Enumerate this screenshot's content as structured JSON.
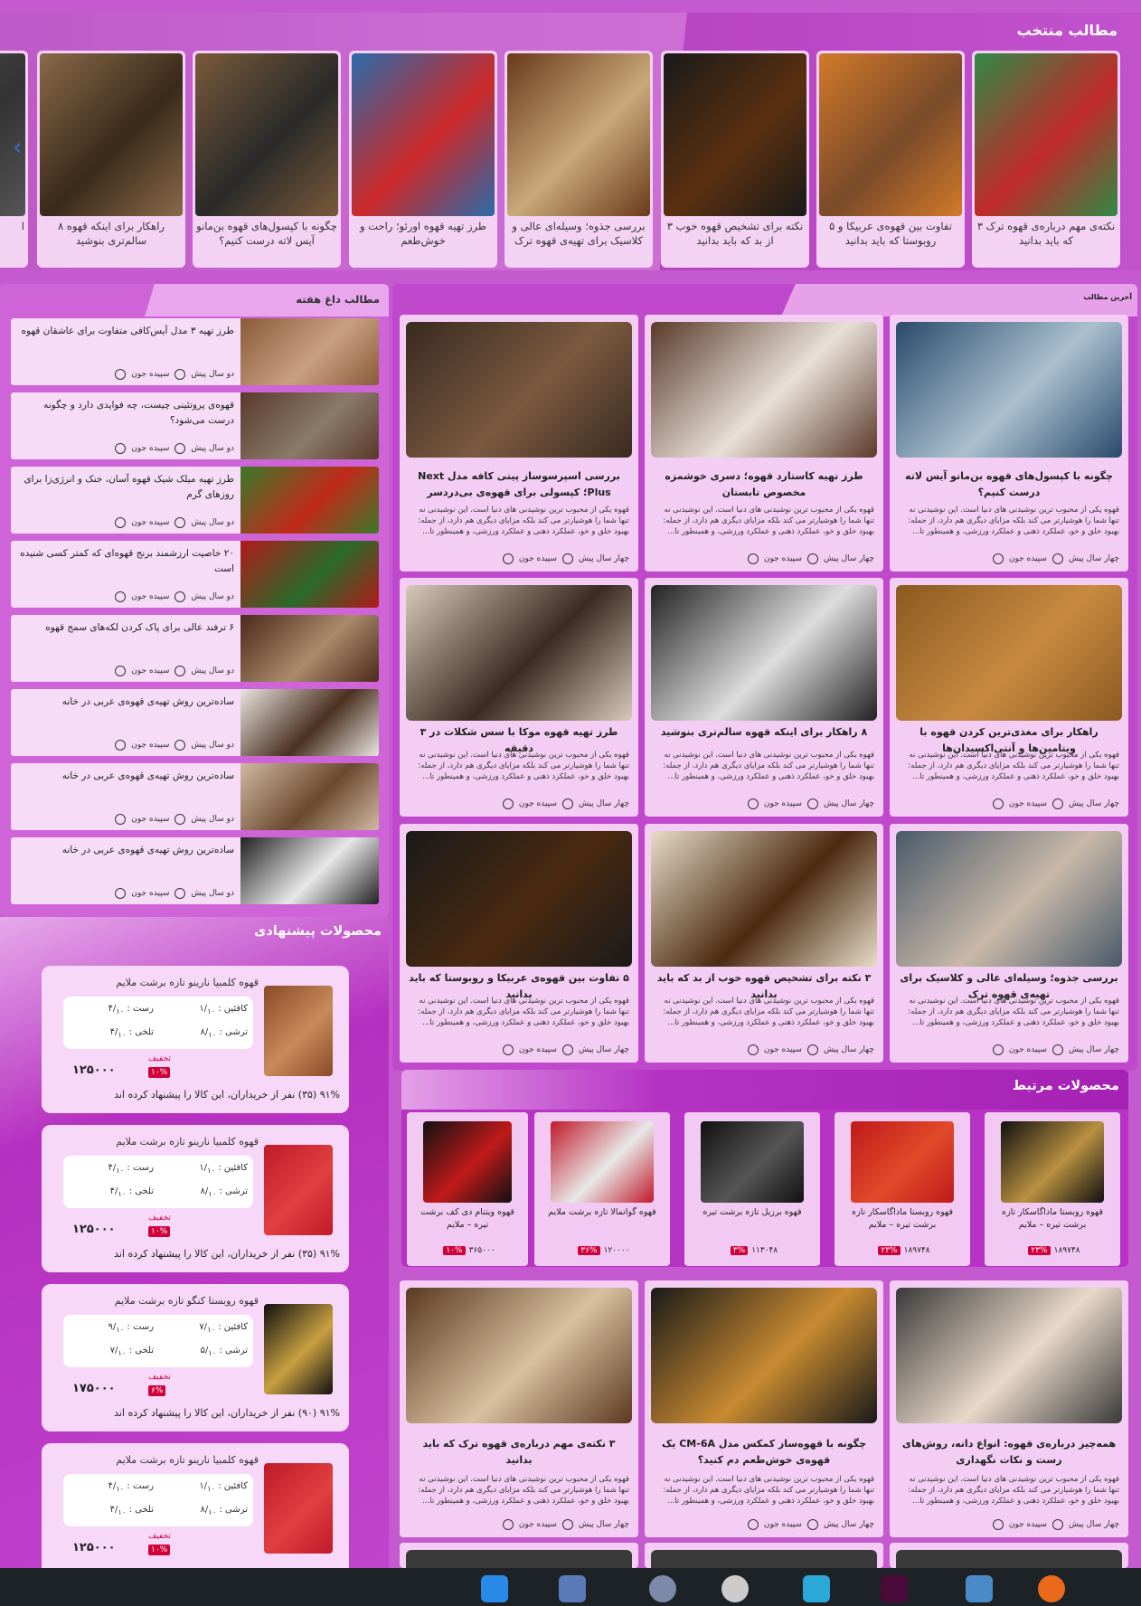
{
  "featured": {
    "title": "مطالب منتخب",
    "items": [
      {
        "caption": "۳ نکته‌ی مهم درباره‌ی قهوه ترک که باید بدانید",
        "colors": [
          "#2e8a46",
          "#c02a2a"
        ]
      },
      {
        "caption": "۵ تفاوت بین قهوه‌ی عربیکا و روبوستا که باید بدانید",
        "colors": [
          "#d27a2a",
          "#7a4a2a"
        ]
      },
      {
        "caption": "۳ نکته برای تشخیص قهوه خوب از بد که باید بدانید",
        "colors": [
          "#1a1a1a",
          "#5a3010"
        ]
      },
      {
        "caption": "بررسی جذوه؛ وسیله‌ای عالی و کلاسیک برای تهیه‌ی قهوه ترک",
        "colors": [
          "#6a3a1a",
          "#c8a878"
        ]
      },
      {
        "caption": "طرز تهیه قهوه اورئو؛ راحت و خوش‌طعم",
        "colors": [
          "#2a6aaa",
          "#cc2a2a"
        ]
      },
      {
        "caption": "چگونه با کپسول‌های قهوه بن‌مانو آیس لاته درست کنیم؟",
        "colors": [
          "#7a5a3a",
          "#2a2a2a"
        ]
      },
      {
        "caption": "۸ راهکار برای اینکه قهوه سالم‌تری بنوشید",
        "colors": [
          "#8a6a4a",
          "#3a2a1a"
        ]
      },
      {
        "caption": "ا",
        "colors": [
          "#555",
          "#333"
        ]
      }
    ],
    "prev_arrow": "‹"
  },
  "weekly": {
    "title": "مطالب داغ هفته",
    "items": [
      {
        "title": "طرز تهیه ۳ مدل آیس‌کافی متفاوت برای عاشقان قهوه",
        "author": "سپیده جون",
        "time": "دو سال پیش",
        "colors": [
          "#8a5a3a",
          "#c8a080"
        ]
      },
      {
        "title": "قهوه‌ی پروتئینی چیست، چه فوایدی دارد و چگونه درست می‌شود؟",
        "author": "سپیده جون",
        "time": "دو سال پیش",
        "colors": [
          "#5a3a2a",
          "#8a7a6a"
        ]
      },
      {
        "title": "طرز تهیه میلک شیک قهوه آسان، خنک و انرژی‌زا برای روزهای گرم",
        "author": "سپیده جون",
        "time": "دو سال پیش",
        "colors": [
          "#3a7a2a",
          "#c02a1a"
        ]
      },
      {
        "title": "۲۰ خاصیت ارزشمند برنج قهوه‌ای که کمتر کسی شنیده است",
        "author": "سپیده جون",
        "time": "دو سال پیش",
        "colors": [
          "#b01a1a",
          "#2a6a2a"
        ]
      },
      {
        "title": "۶ ترفند عالی برای پاک کردن لکه‌های سمج قهوه",
        "author": "سپیده جون",
        "time": "دو سال پیش",
        "colors": [
          "#4a2a1a",
          "#aa8a6a"
        ]
      },
      {
        "title": "ساده‌ترین روش تهیه‌ی قهوه‌ی عربی در خانه",
        "author": "سپیده جون",
        "time": "دو سال پیش",
        "colors": [
          "#e8e4e0",
          "#4a3020"
        ]
      },
      {
        "title": "ساده‌ترین روش تهیه‌ی قهوه‌ی عربی در خانه",
        "author": "سپیده جون",
        "time": "دو سال پیش",
        "colors": [
          "#d0b8a0",
          "#6a4a30"
        ]
      },
      {
        "title": "ساده‌ترین روش تهیه‌ی قهوه‌ی عربی در خانه",
        "author": "سپیده جون",
        "time": "دو سال پیش",
        "colors": [
          "#222",
          "#e8e8e8"
        ]
      }
    ]
  },
  "suggested": {
    "title": "محصولات پیشنهادی",
    "labels": {
      "caffeine": "کافئین :",
      "body": "رست :",
      "acidity": "ترشی :",
      "bitterness": "تلخی :",
      "discount": "تخفیف",
      "out_of": "۱۰"
    },
    "items": [
      {
        "name": "قهوه کلمبیا نارینو تازه برشت ملایم",
        "caffeine": "۱/",
        "body": "۴/",
        "acidity": "۸/",
        "bitterness": "۴/",
        "price": "۱۲۵۰۰۰",
        "discount": "۱۰%",
        "recommend": "۹۱% (۳۵) نفر از خریداران، این کالا را پیشنهاد کرده اند",
        "colors": [
          "#8a4a2a",
          "#c88a5a"
        ]
      },
      {
        "name": "قهوه کلمبیا نارینو تازه برشت ملایم",
        "caffeine": "۱/",
        "body": "۴/",
        "acidity": "۸/",
        "bitterness": "۴/",
        "price": "۱۲۵۰۰۰",
        "discount": "۱۰%",
        "recommend": "۹۱% (۳۵) نفر از خریداران، این کالا را پیشنهاد کرده اند",
        "colors": [
          "#c01a2a",
          "#e04040"
        ]
      },
      {
        "name": "قهوه روبستا کنگو تازه برشت ملایم",
        "caffeine": "۷/",
        "body": "۹/",
        "acidity": "۵/",
        "bitterness": "۷/",
        "price": "۱۷۵۰۰۰",
        "discount": "۶%",
        "recommend": "۹۱% (۹۰) نفر از خریداران، این کالا را پیشنهاد کرده اند",
        "colors": [
          "#111",
          "#c8a040"
        ]
      },
      {
        "name": "قهوه کلمبیا نارینو تازه برشت ملایم",
        "caffeine": "۱/",
        "body": "۴/",
        "acidity": "۸/",
        "bitterness": "۴/",
        "price": "۱۲۵۰۰۰",
        "discount": "۱۰%",
        "recommend": "",
        "colors": [
          "#c01a2a",
          "#e04040"
        ]
      }
    ]
  },
  "latest": {
    "title": "آخرین مطالب",
    "excerpt": "قهوه یکی از محبوب ترین نوشیدنی های دنیا است. این نوشیدنی نه تنها شما را هوشیارتر می کند بلکه مزایای دیگری هم دارد، از جمله: بهبود خلق و خو، عملکرد ذهنی و عملکرد ورزشی، و همینطور تا...",
    "posts": [
      {
        "title": "چگونه با کپسول‌های قهوه بن‌مانو آیس لاته درست کنیم؟",
        "author": "سپیده جون",
        "time": "چهار سال پیش",
        "colors": [
          "#2a4a6a",
          "#aac0d0"
        ]
      },
      {
        "title": "طرز تهیه کاستارد قهوه؛ دسری خوشمزه مخصوص تابستان",
        "author": "سپیده جون",
        "time": "چهار سال پیش",
        "colors": [
          "#5a3a2a",
          "#e8e0d8"
        ]
      },
      {
        "title": "بررسی اسپرسوساز پیتی کافه مدل Next Plus؛ کپسولی برای قهوه‌ی بی‌دردسر",
        "author": "سپیده جون",
        "time": "چهار سال پیش",
        "colors": [
          "#3a2a20",
          "#7a5a40"
        ]
      },
      {
        "title": "راهکار برای مغذی‌ترین کردن قهوه با ویتامین‌ها و آنتی‌اکسیدان‌ها",
        "author": "سپیده جون",
        "time": "چهار سال پیش",
        "colors": [
          "#8a5a20",
          "#c88a40"
        ]
      },
      {
        "title": "۸ راهکار برای اینکه قهوه سالم‌تری بنوشید",
        "author": "سپیده جون",
        "time": "چهار سال پیش",
        "colors": [
          "#222",
          "#ddd"
        ]
      },
      {
        "title": "طرز تهیه قهوه موکا با سس شکلات در ۳ دقیقه",
        "author": "سپیده جون",
        "time": "چهار سال پیش",
        "colors": [
          "#d8c8b8",
          "#3a2a20"
        ]
      },
      {
        "title": "بررسی جذوه؛ وسیله‌ای عالی و کلاسیک برای تهیه‌ی قهوه ترک",
        "author": "سپیده جون",
        "time": "چهار سال پیش",
        "colors": [
          "#4a5a6a",
          "#c8b8a8"
        ]
      },
      {
        "title": "۳ نکته برای تشخیص قهوه خوب از بد که باید بدانید",
        "author": "سپیده جون",
        "time": "چهار سال پیش",
        "colors": [
          "#e8dcc8",
          "#4a2a10"
        ]
      },
      {
        "title": "۵ تفاوت بین قهوه‌ی عربیکا و روبوستا که باید بدانید",
        "author": "سپیده جون",
        "time": "چهار سال پیش",
        "colors": [
          "#1a1a1a",
          "#4a2a10"
        ]
      }
    ],
    "posts_bottom": [
      {
        "title": "همه‌چیز درباره‌ی قهوه: انواع دانه، روش‌های رست و نکات نگهداری",
        "author": "سپیده جون",
        "time": "چهار سال پیش",
        "colors": [
          "#3a3a3a",
          "#e8d8c8"
        ]
      },
      {
        "title": "چگونه با قهوه‌ساز کمکس مدل CM-6A یک قهوه‌ی خوش‌طعم دم کنید؟",
        "author": "سپیده جون",
        "time": "چهار سال پیش",
        "colors": [
          "#1a1a1a",
          "#c88a30"
        ]
      },
      {
        "title": "۳ نکته‌ی مهم درباره‌ی قهوه ترک که باید بدانید",
        "author": "سپیده جون",
        "time": "چهار سال پیش",
        "colors": [
          "#5a3a20",
          "#d8c0a0"
        ]
      }
    ]
  },
  "related": {
    "title": "محصولات مرتبط",
    "items": [
      {
        "name": "قهوه روبستا ماداگاسکار تازه برشت تیره – ملایم",
        "discount": "۲۳%",
        "price": "۱۸۹۷۴۸",
        "colors": [
          "#111",
          "#b89040"
        ]
      },
      {
        "name": "قهوه روبستا ماداگاسکار تازه برشت تیره – ملایم",
        "discount": "۲۳%",
        "price": "۱۸۹۷۴۸",
        "colors": [
          "#c01a1a",
          "#e04a2a"
        ]
      },
      {
        "name": "قهوه برزیل تازه برشت تیره",
        "discount": "۳%",
        "price": "۱۱۳۰۴۸",
        "colors": [
          "#111",
          "#555"
        ]
      },
      {
        "name": "قهوه گواتمالا تازه برشت ملایم",
        "discount": "۳۶%",
        "price": "۱۲۰۰۰۰",
        "colors": [
          "#c01a2a",
          "#e8e8e8"
        ]
      },
      {
        "name": "قهوه ویتنام دی کف برشت تیره – ملایم",
        "discount": "۱۰%",
        "price": "۳۶۵۰۰۰",
        "colors": [
          "#111",
          "#c01a1a"
        ]
      }
    ]
  }
}
